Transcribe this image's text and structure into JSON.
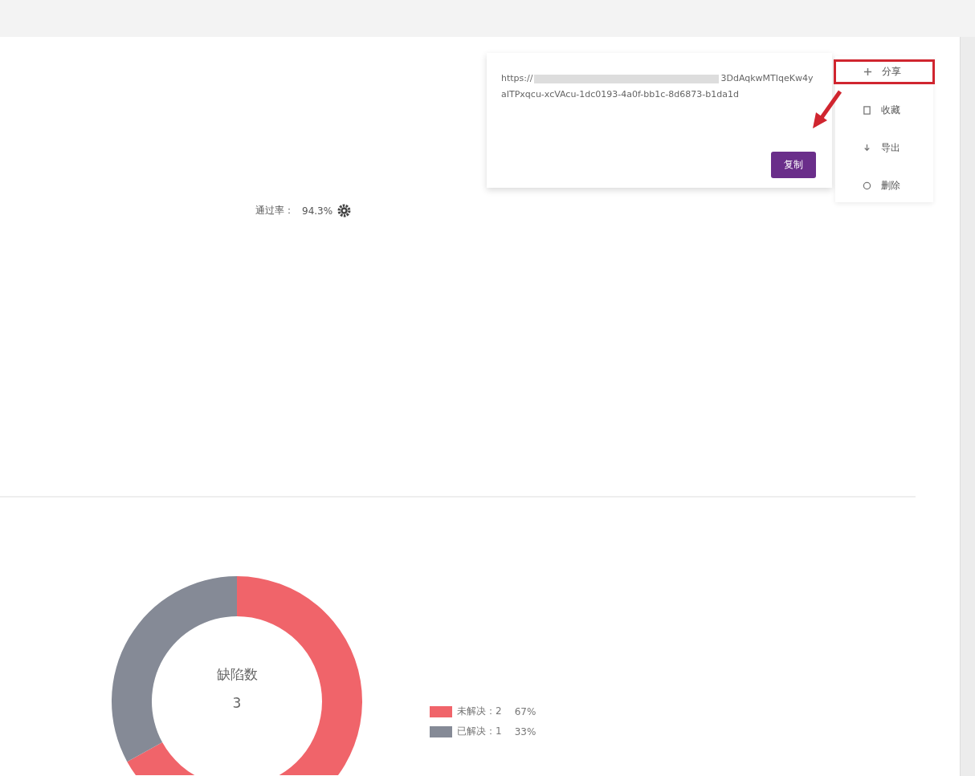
{
  "stat": {
    "label": "通过率：",
    "value": "94.3%"
  },
  "popover": {
    "link_lines": [
      "https://",
      "3DdAqkwMTIqeKw4yaI",
      "TPxqcu-xcVAcu-1dc0193-4a0f-bb1c-8d6873-b1da",
      "1d"
    ],
    "button": "复制"
  },
  "menu": [
    {
      "label": "分享"
    },
    {
      "label": "收藏"
    },
    {
      "label": "导出"
    },
    {
      "label": "删除"
    }
  ],
  "chart": {
    "center_label": "缺陷数",
    "center_value": "3",
    "legend": [
      {
        "percent": "67%",
        "color": "#f0646a"
      },
      {
        "percent": "33%",
        "color": "#858a96"
      }
    ],
    "chart_data": {
      "type": "donut",
      "categories": [
        "未解决：2",
        "已解决：1"
      ],
      "values": [
        67,
        33
      ]
    }
  }
}
